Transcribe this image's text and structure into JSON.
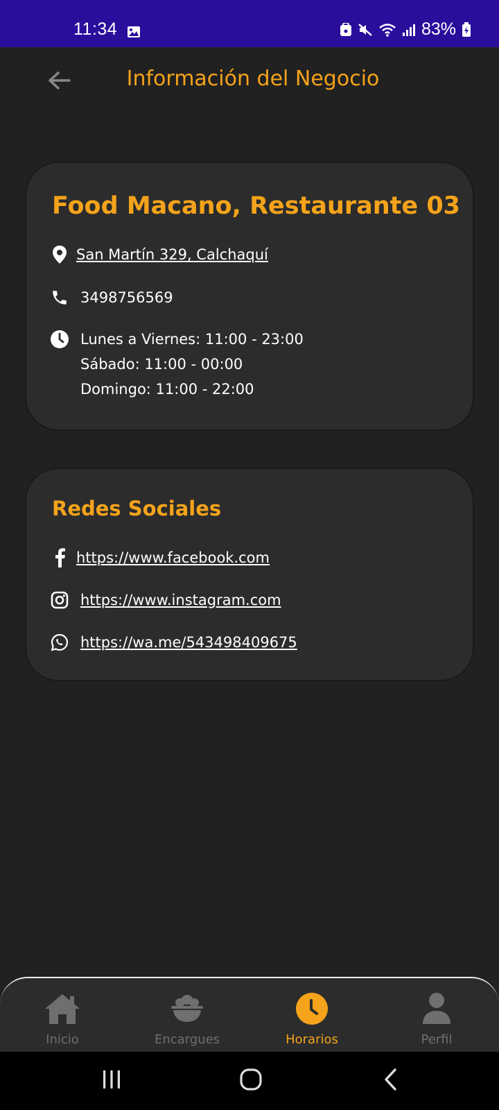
{
  "status_bar": {
    "time": "11:34",
    "battery": "83%",
    "icons": [
      "gallery-icon",
      "lock-icon",
      "mute-icon",
      "wifi-icon",
      "signal-icon",
      "battery-icon"
    ]
  },
  "header": {
    "title": "Información del Negocio",
    "back_icon": "arrow-left-icon"
  },
  "business": {
    "name": "Food Macano, Restaurante 03",
    "address": "San Martín 329, Calchaquí",
    "phone": "3498756569",
    "hours": [
      "Lunes a Viernes: 11:00 - 23:00",
      "Sábado: 11:00 - 00:00",
      "Domingo: 11:00 - 22:00"
    ]
  },
  "social": {
    "title": "Redes Sociales",
    "facebook": "https://www.facebook.com",
    "instagram": "https://www.instagram.com",
    "whatsapp": "https://wa.me/543498409675"
  },
  "bottom_nav": {
    "items": [
      {
        "label": "Inicio",
        "icon": "home-icon",
        "active": false
      },
      {
        "label": "Encargues",
        "icon": "food-bowl-icon",
        "active": false
      },
      {
        "label": "Horarios",
        "icon": "clock-icon",
        "active": true
      },
      {
        "label": "Perfil",
        "icon": "person-icon",
        "active": false
      }
    ]
  },
  "colors": {
    "accent": "#f5a31a",
    "status_bar": "#2b0d9c",
    "background": "#212121",
    "card": "#2c2c2c",
    "inactive": "#6f6f6f"
  }
}
